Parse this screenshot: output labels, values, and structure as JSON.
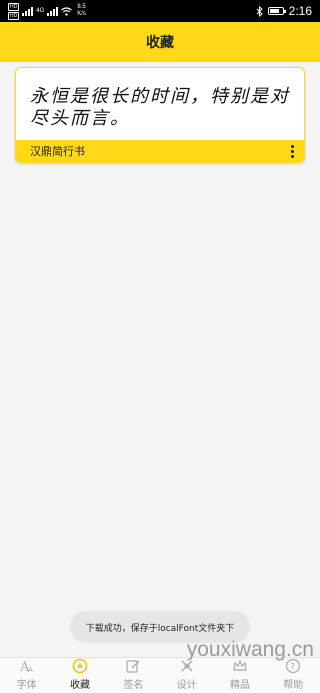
{
  "status_bar": {
    "sim1": "HD",
    "sim2": "HD",
    "network": "4G",
    "speed_value": "8.5",
    "speed_unit": "K/s",
    "time": "2:16"
  },
  "header": {
    "title": "收藏"
  },
  "favorites": [
    {
      "preview_text": "永恒是很长的时间，特别是对尽头而言。",
      "font_name": "汉鼎简行书"
    }
  ],
  "toast": {
    "message": "下载成功，保存于localFont文件夹下"
  },
  "bottom_nav": {
    "items": [
      {
        "label": "字体",
        "icon": "font-icon",
        "active": false
      },
      {
        "label": "收藏",
        "icon": "favorite-icon",
        "active": true
      },
      {
        "label": "签名",
        "icon": "edit-icon",
        "active": false
      },
      {
        "label": "设计",
        "icon": "design-icon",
        "active": false
      },
      {
        "label": "精品",
        "icon": "premium-icon",
        "active": false
      },
      {
        "label": "帮助",
        "icon": "help-icon",
        "active": false
      }
    ]
  },
  "watermark": {
    "text": "youxiwang.cn"
  },
  "colors": {
    "accent": "#ffd817",
    "background": "#f4f4f4"
  }
}
